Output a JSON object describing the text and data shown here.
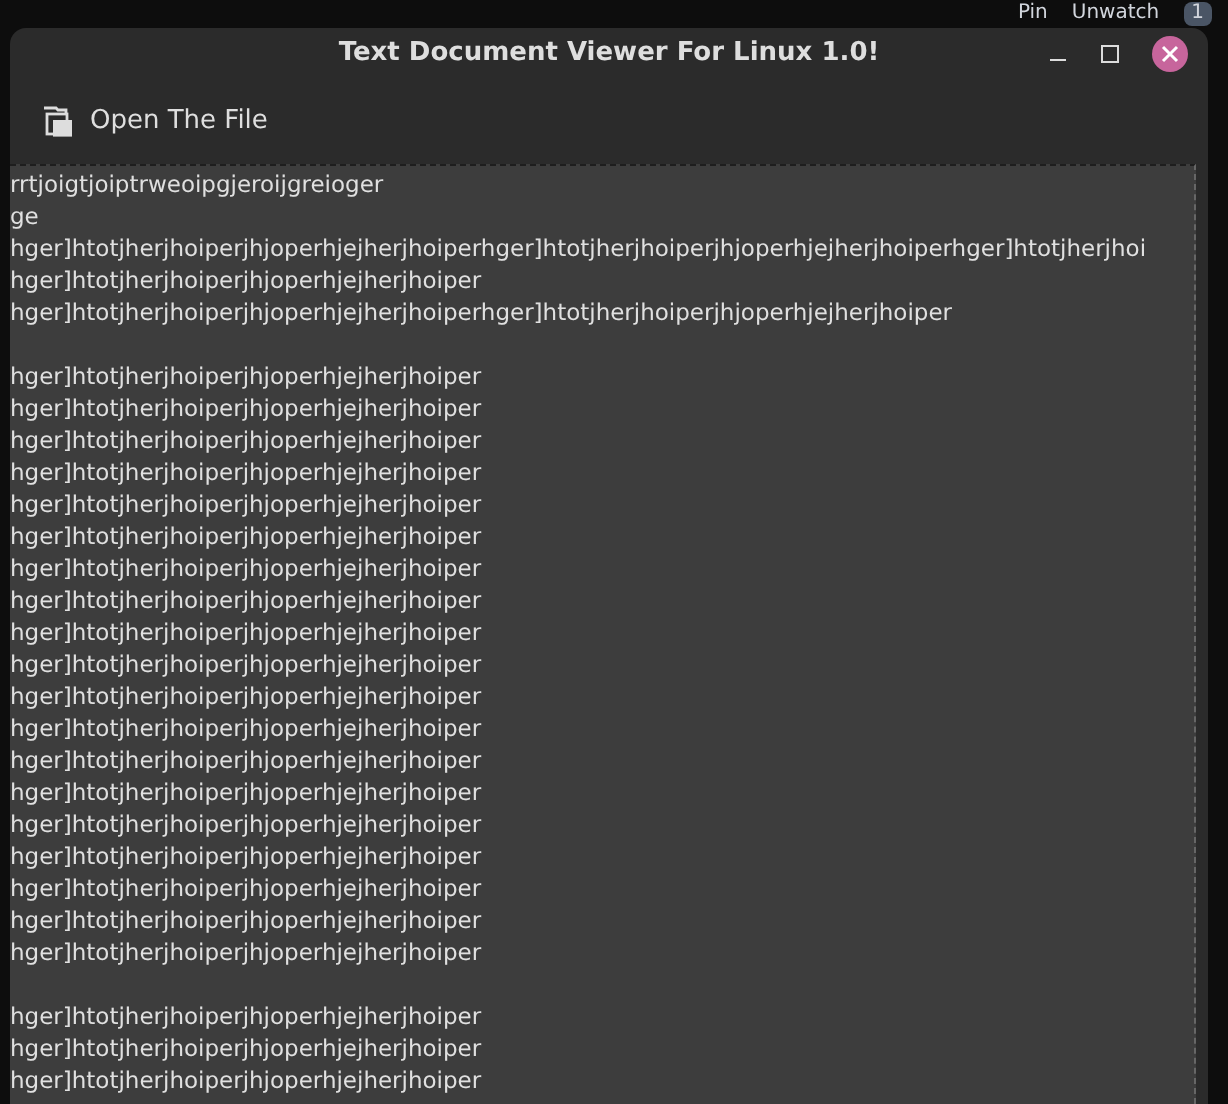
{
  "background": {
    "pin_label": "Pin",
    "watch_label": "Unwatch",
    "watch_count": "1"
  },
  "window": {
    "title": "Text Document Viewer For Linux 1.0!"
  },
  "toolbar": {
    "open_button": "Open The File"
  },
  "document": {
    "paragraphs": [
      [
        "rrtjoigtjoiptrweoipgjeroijgreioger",
        "ge",
        "hger]htotjherjhoiperjhjoperhjejherjhoiperhger]htotjherjhoiperjhjoperhjejherjhoiperhger]htotjherjhoi",
        "hger]htotjherjhoiperjhjoperhjejherjhoiper",
        "hger]htotjherjhoiperjhjoperhjejherjhoiperhger]htotjherjhoiperjhjoperhjejherjhoiper"
      ],
      [
        "hger]htotjherjhoiperjhjoperhjejherjhoiper",
        "hger]htotjherjhoiperjhjoperhjejherjhoiper",
        "hger]htotjherjhoiperjhjoperhjejherjhoiper",
        "hger]htotjherjhoiperjhjoperhjejherjhoiper",
        "hger]htotjherjhoiperjhjoperhjejherjhoiper",
        "hger]htotjherjhoiperjhjoperhjejherjhoiper",
        "hger]htotjherjhoiperjhjoperhjejherjhoiper",
        "hger]htotjherjhoiperjhjoperhjejherjhoiper",
        "hger]htotjherjhoiperjhjoperhjejherjhoiper",
        "hger]htotjherjhoiperjhjoperhjejherjhoiper",
        "hger]htotjherjhoiperjhjoperhjejherjhoiper",
        "hger]htotjherjhoiperjhjoperhjejherjhoiper",
        "hger]htotjherjhoiperjhjoperhjejherjhoiper",
        "hger]htotjherjhoiperjhjoperhjejherjhoiper",
        "hger]htotjherjhoiperjhjoperhjejherjhoiper",
        "hger]htotjherjhoiperjhjoperhjejherjhoiper",
        "hger]htotjherjhoiperjhjoperhjejherjhoiper",
        "hger]htotjherjhoiperjhjoperhjejherjhoiper",
        "hger]htotjherjhoiperjhjoperhjejherjhoiper"
      ],
      [
        "hger]htotjherjhoiperjhjoperhjejherjhoiper",
        "hger]htotjherjhoiperjhjoperhjejherjhoiper",
        "hger]htotjherjhoiperjhjoperhjejherjhoiper"
      ]
    ]
  }
}
